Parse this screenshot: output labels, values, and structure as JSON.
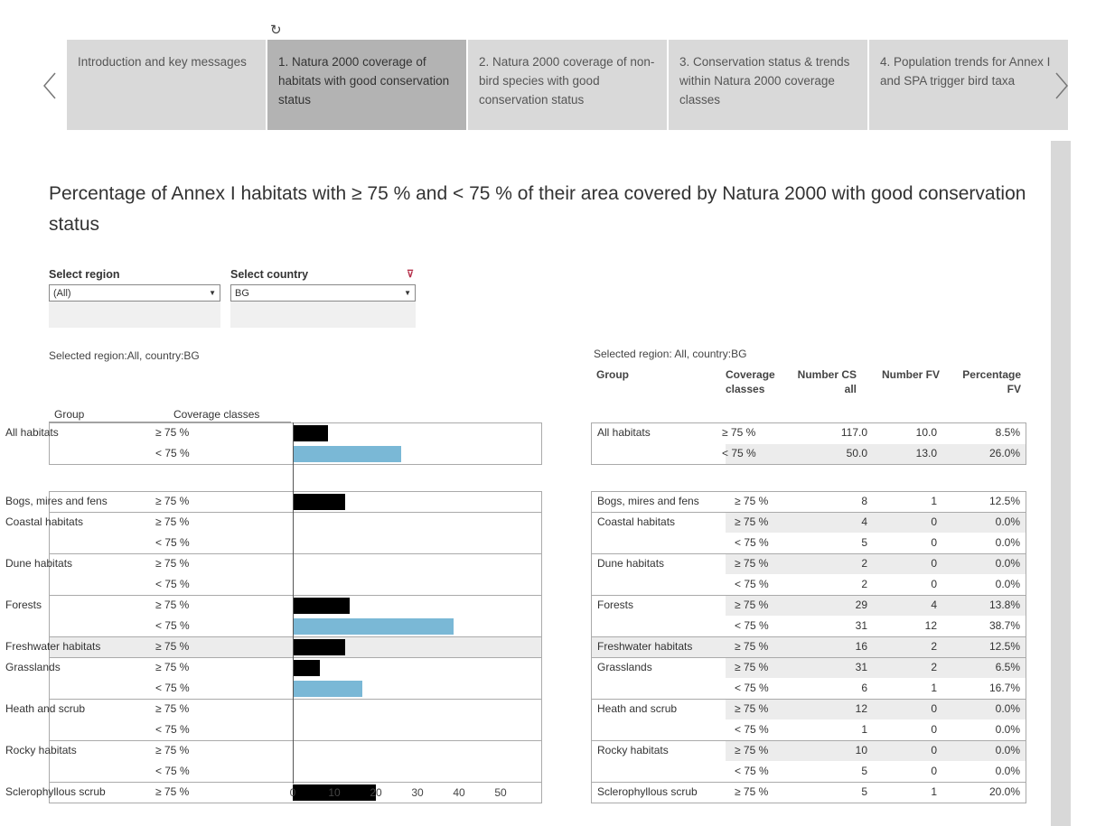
{
  "tabs": [
    {
      "label": "Introduction and key messages",
      "active": false
    },
    {
      "label": "1. Natura 2000 coverage of habitats with good conservation status",
      "active": true
    },
    {
      "label": "2. Natura 2000 coverage of non-bird species with good conservation status",
      "active": false
    },
    {
      "label": "3. Conservation status & trends within Natura 2000 coverage classes",
      "active": false
    },
    {
      "label": "4. Population trends for Annex I and SPA trigger bird taxa",
      "active": false
    }
  ],
  "icons": {
    "refresh": "refresh-icon",
    "prev": "chevron-left-icon",
    "next": "chevron-right-icon",
    "clear_filter": "clear-filter-icon"
  },
  "title": "Percentage of Annex I habitats with ≥ 75 % and < 75 % of their area covered by Natura 2000 with good conservation status",
  "filters": {
    "region": {
      "label": "Select region",
      "value": "(All)"
    },
    "country": {
      "label": "Select country",
      "value": "BG"
    }
  },
  "left_subtitle": "Selected region:All, country:BG",
  "right_subtitle": "Selected region: All, country:BG",
  "left_headers": {
    "group": "Group",
    "coverage": "Coverage classes"
  },
  "table_headers": {
    "group": "Group",
    "coverage": "Coverage classes",
    "number_cs": "Number CS all",
    "number_fv": "Number FV",
    "percentage": "Percentage FV"
  },
  "colors": {
    "ge75": "#000000",
    "lt75": "#7ab8d6"
  },
  "chart_data": {
    "type": "bar",
    "orientation": "horizontal",
    "xlim": [
      0,
      50
    ],
    "xticks": [
      "0",
      "10",
      "20",
      "30",
      "40",
      "50"
    ],
    "groups": [
      {
        "group": "All habitats",
        "rows": [
          {
            "coverage": "≥ 75 %",
            "value": 8.5,
            "cs": "117.0",
            "fv": "10.0",
            "pct": "8.5%"
          },
          {
            "coverage": "< 75 %",
            "value": 26.0,
            "cs": "50.0",
            "fv": "13.0",
            "pct": "26.0%"
          }
        ]
      },
      {
        "group": "Bogs, mires and fens",
        "rows": [
          {
            "coverage": "≥ 75 %",
            "value": 12.5,
            "cs": "8",
            "fv": "1",
            "pct": "12.5%"
          }
        ]
      },
      {
        "group": "Coastal habitats",
        "rows": [
          {
            "coverage": "≥ 75 %",
            "value": 0,
            "cs": "4",
            "fv": "0",
            "pct": "0.0%"
          },
          {
            "coverage": "< 75 %",
            "value": 0,
            "cs": "5",
            "fv": "0",
            "pct": "0.0%"
          }
        ]
      },
      {
        "group": "Dune habitats",
        "rows": [
          {
            "coverage": "≥ 75 %",
            "value": 0,
            "cs": "2",
            "fv": "0",
            "pct": "0.0%"
          },
          {
            "coverage": "< 75 %",
            "value": 0,
            "cs": "2",
            "fv": "0",
            "pct": "0.0%"
          }
        ]
      },
      {
        "group": "Forests",
        "rows": [
          {
            "coverage": "≥ 75 %",
            "value": 13.8,
            "cs": "29",
            "fv": "4",
            "pct": "13.8%"
          },
          {
            "coverage": "< 75 %",
            "value": 38.7,
            "cs": "31",
            "fv": "12",
            "pct": "38.7%"
          }
        ]
      },
      {
        "group": "Freshwater habitats",
        "rows": [
          {
            "coverage": "≥ 75 %",
            "value": 12.5,
            "cs": "16",
            "fv": "2",
            "pct": "12.5%"
          }
        ]
      },
      {
        "group": "Grasslands",
        "rows": [
          {
            "coverage": "≥ 75 %",
            "value": 6.5,
            "cs": "31",
            "fv": "2",
            "pct": "6.5%"
          },
          {
            "coverage": "< 75 %",
            "value": 16.7,
            "cs": "6",
            "fv": "1",
            "pct": "16.7%"
          }
        ]
      },
      {
        "group": "Heath and scrub",
        "rows": [
          {
            "coverage": "≥ 75 %",
            "value": 0,
            "cs": "12",
            "fv": "0",
            "pct": "0.0%"
          },
          {
            "coverage": "< 75 %",
            "value": 0,
            "cs": "1",
            "fv": "0",
            "pct": "0.0%"
          }
        ]
      },
      {
        "group": "Rocky habitats",
        "rows": [
          {
            "coverage": "≥ 75 %",
            "value": 0,
            "cs": "10",
            "fv": "0",
            "pct": "0.0%"
          },
          {
            "coverage": "< 75 %",
            "value": 0,
            "cs": "5",
            "fv": "0",
            "pct": "0.0%"
          }
        ]
      },
      {
        "group": "Sclerophyllous scrub",
        "rows": [
          {
            "coverage": "≥ 75 %",
            "value": 20.0,
            "cs": "5",
            "fv": "1",
            "pct": "20.0%"
          }
        ]
      }
    ]
  }
}
